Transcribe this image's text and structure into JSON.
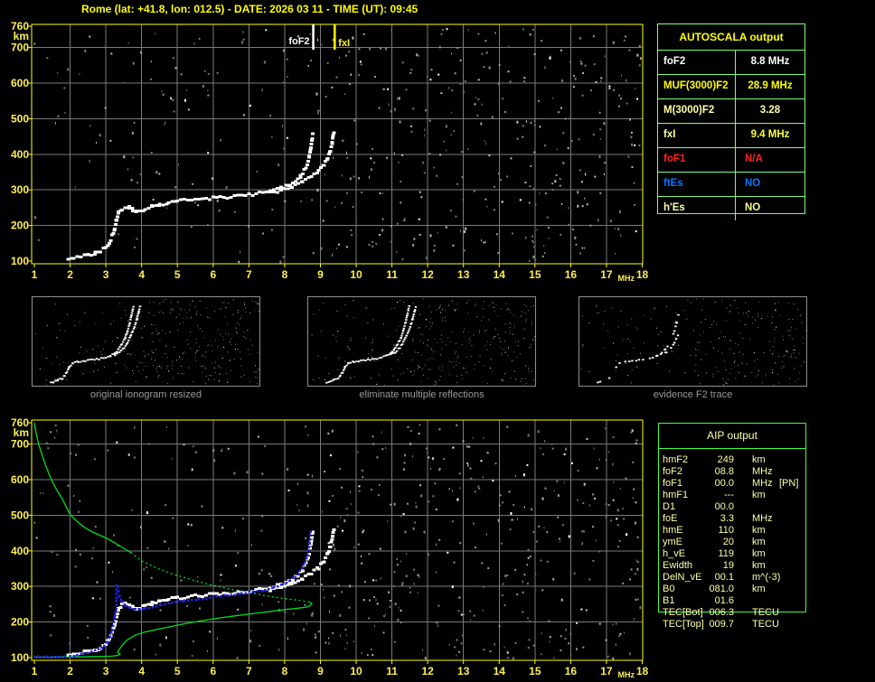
{
  "title": "Rome (lat: +41.8, lon: 012.5) - DATE: 2026 03 11 - TIME (UT): 09:45",
  "colors": {
    "background": "#000000",
    "title_yellow": "#ffff00",
    "axis_label": "#ffee55",
    "plot_border": "#ffff00",
    "grid": "#7a7a7a",
    "trace_white": "#ffffff",
    "trace_blue": "#2222ee",
    "profile_green": "#00dd22",
    "autoscala_border": "#7dff7d",
    "aip_border": "#3dff3d",
    "aip_text": "#ffffa8",
    "caption_gray": "#9a9a9a"
  },
  "autoscala": {
    "title": "AUTOSCALA output",
    "rows": [
      {
        "label": "foF2",
        "value": "8.8 MHz",
        "label_color": "#ffffff",
        "value_color": "#ffffff",
        "align": "center"
      },
      {
        "label": "MUF(3000)F2",
        "value": "28.9 MHz",
        "label_color": "#ffff00",
        "value_color": "#ffff00",
        "align": "center"
      },
      {
        "label": "M(3000)F2",
        "value": "3.28",
        "label_color": "#ffffaa",
        "value_color": "#ffffaa",
        "align": "center"
      },
      {
        "label": "fxI",
        "value": "9.4 MHz",
        "label_color": "#ffffaa",
        "value_color": "#ffff44",
        "align": "center"
      },
      {
        "label": "foF1",
        "value": "N/A",
        "label_color": "#ff2222",
        "value_color": "#ff2222",
        "align": "left"
      },
      {
        "label": "ftEs",
        "value": "NO",
        "label_color": "#0077ff",
        "value_color": "#0077ff",
        "align": "left"
      },
      {
        "label": "h'Es",
        "value": "NO",
        "label_color": "#ffffaa",
        "value_color": "#ffff88",
        "align": "left"
      }
    ]
  },
  "aip": {
    "title": "AIP output",
    "rows": [
      {
        "name": "hmF2",
        "value": "249",
        "unit": "km",
        "note": ""
      },
      {
        "name": "foF2",
        "value": "08.8",
        "unit": "MHz",
        "note": ""
      },
      {
        "name": "foF1",
        "value": "00.0",
        "unit": "MHz",
        "note": "[PN]"
      },
      {
        "name": "hmF1",
        "value": "---",
        "unit": "km",
        "note": ""
      },
      {
        "name": "D1",
        "value": "00.0",
        "unit": "",
        "note": ""
      },
      {
        "name": "foE",
        "value": "3.3",
        "unit": "MHz",
        "note": ""
      },
      {
        "name": "hmE",
        "value": "110",
        "unit": "km",
        "note": ""
      },
      {
        "name": "ymE",
        "value": "20",
        "unit": "km",
        "note": ""
      },
      {
        "name": "h_vE",
        "value": "119",
        "unit": "km",
        "note": ""
      },
      {
        "name": "Ewidth",
        "value": "19",
        "unit": "km",
        "note": ""
      },
      {
        "name": "DelN_vE",
        "value": "00.1",
        "unit": "m^(-3)",
        "note": ""
      },
      {
        "name": "B0",
        "value": "081.0",
        "unit": "km",
        "note": ""
      },
      {
        "name": "B1",
        "value": "01.6",
        "unit": "",
        "note": ""
      },
      {
        "name": "TEC[Bot]",
        "value": "006.3",
        "unit": "TECU",
        "note": ""
      },
      {
        "name": "TEC[Top]",
        "value": "009.7",
        "unit": "TECU",
        "note": ""
      }
    ]
  },
  "thumbnails": [
    {
      "caption": "original ionogram resized"
    },
    {
      "caption": "eliminate multiple reflections"
    },
    {
      "caption": "evidence F2 trace"
    }
  ],
  "chart_data": {
    "type": "scatter",
    "title": "ionogram virtual height vs frequency",
    "xlabel": "MHz",
    "ylabel": "km",
    "x_ticks": [
      1,
      2,
      3,
      4,
      5,
      6,
      7,
      8,
      9,
      10,
      11,
      12,
      13,
      14,
      15,
      16,
      17,
      18
    ],
    "y_ticks": [
      760,
      700,
      600,
      500,
      400,
      300,
      200,
      100
    ],
    "y_grid": [
      700,
      600,
      500,
      400,
      300,
      200
    ],
    "xlim": [
      1,
      18
    ],
    "ylim": [
      100,
      760
    ],
    "top_plot_markers": [
      {
        "label": "foF2",
        "f": 8.8,
        "color": "#ffffff"
      },
      {
        "label": "fxI",
        "f": 9.4,
        "color": "#ffff00"
      }
    ],
    "trace_o_mode": [
      [
        1.95,
        108
      ],
      [
        2.1,
        110
      ],
      [
        2.3,
        113
      ],
      [
        2.5,
        117
      ],
      [
        2.7,
        122
      ],
      [
        2.85,
        128
      ],
      [
        3.0,
        138
      ],
      [
        3.1,
        152
      ],
      [
        3.18,
        170
      ],
      [
        3.25,
        192
      ],
      [
        3.3,
        215
      ],
      [
        3.35,
        235
      ],
      [
        3.45,
        247
      ],
      [
        3.55,
        252
      ],
      [
        3.65,
        250
      ],
      [
        3.75,
        244
      ],
      [
        3.85,
        240
      ],
      [
        3.95,
        241
      ],
      [
        4.1,
        246
      ],
      [
        4.3,
        253
      ],
      [
        4.5,
        259
      ],
      [
        4.75,
        264
      ],
      [
        5.0,
        268
      ],
      [
        5.3,
        271
      ],
      [
        5.6,
        274
      ],
      [
        5.9,
        276
      ],
      [
        6.2,
        278
      ],
      [
        6.5,
        281
      ],
      [
        6.8,
        284
      ],
      [
        7.1,
        288
      ],
      [
        7.4,
        293
      ],
      [
        7.7,
        299
      ],
      [
        7.95,
        306
      ],
      [
        8.15,
        315
      ],
      [
        8.3,
        325
      ],
      [
        8.45,
        339
      ],
      [
        8.55,
        355
      ],
      [
        8.63,
        373
      ],
      [
        8.69,
        394
      ],
      [
        8.73,
        416
      ],
      [
        8.76,
        437
      ],
      [
        8.78,
        455
      ],
      [
        8.79,
        465
      ]
    ],
    "trace_x_mode": [
      [
        7.6,
        291
      ],
      [
        7.9,
        299
      ],
      [
        8.2,
        309
      ],
      [
        8.5,
        322
      ],
      [
        8.75,
        336
      ],
      [
        8.95,
        352
      ],
      [
        9.1,
        370
      ],
      [
        9.2,
        390
      ],
      [
        9.28,
        412
      ],
      [
        9.33,
        434
      ],
      [
        9.36,
        452
      ],
      [
        9.38,
        465
      ]
    ],
    "restored_trace_blue": [
      [
        [
          1.0,
          102
        ],
        [
          1.88,
          102
        ]
      ],
      [
        [
          2.0,
          104
        ],
        [
          2.2,
          108
        ],
        [
          2.4,
          112
        ],
        [
          2.6,
          117
        ],
        [
          2.8,
          124
        ],
        [
          2.95,
          133
        ],
        [
          3.05,
          146
        ],
        [
          3.12,
          161
        ],
        [
          3.18,
          179
        ],
        [
          3.23,
          199
        ],
        [
          3.26,
          218
        ],
        [
          3.28,
          234
        ]
      ],
      [
        [
          3.29,
          238
        ],
        [
          3.29,
          306
        ]
      ],
      [
        [
          3.33,
          296
        ],
        [
          3.38,
          272
        ],
        [
          3.45,
          256
        ],
        [
          3.55,
          246
        ],
        [
          3.68,
          239
        ],
        [
          3.82,
          235
        ],
        [
          3.95,
          235
        ],
        [
          4.1,
          238
        ],
        [
          4.3,
          243
        ],
        [
          4.55,
          249
        ],
        [
          4.85,
          255
        ],
        [
          5.2,
          260
        ],
        [
          5.6,
          265
        ],
        [
          6.0,
          270
        ],
        [
          6.4,
          275
        ],
        [
          6.8,
          280
        ],
        [
          7.15,
          285
        ],
        [
          7.45,
          291
        ],
        [
          7.7,
          298
        ],
        [
          7.95,
          306
        ],
        [
          8.15,
          316
        ],
        [
          8.3,
          328
        ],
        [
          8.43,
          342
        ],
        [
          8.53,
          359
        ],
        [
          8.61,
          379
        ],
        [
          8.66,
          400
        ],
        [
          8.7,
          422
        ],
        [
          8.72,
          443
        ],
        [
          8.73,
          460
        ]
      ]
    ],
    "profile_topside_solid": [
      [
        1.0,
        760
      ],
      [
        1.05,
        730
      ],
      [
        1.12,
        700
      ],
      [
        1.22,
        668
      ],
      [
        1.33,
        636
      ],
      [
        1.45,
        606
      ],
      [
        1.6,
        576
      ],
      [
        1.78,
        546
      ],
      [
        2.0,
        502
      ],
      [
        2.2,
        482
      ],
      [
        2.4,
        466
      ],
      [
        2.6,
        454
      ],
      [
        2.85,
        443
      ],
      [
        3.07,
        433
      ],
      [
        3.35,
        416
      ],
      [
        3.58,
        402
      ],
      [
        3.7,
        395
      ]
    ],
    "profile_dotted": [
      [
        3.7,
        395
      ],
      [
        4.0,
        372
      ],
      [
        4.4,
        352
      ],
      [
        4.8,
        337
      ],
      [
        5.2,
        325
      ],
      [
        5.6,
        313
      ],
      [
        6.0,
        303
      ],
      [
        6.5,
        292
      ],
      [
        7.0,
        283
      ],
      [
        7.5,
        273
      ],
      [
        8.0,
        266
      ],
      [
        8.4,
        261
      ],
      [
        8.7,
        256
      ]
    ],
    "profile_bottomside_solid": [
      [
        8.7,
        256
      ],
      [
        8.76,
        251
      ],
      [
        8.72,
        246
      ],
      [
        8.6,
        242
      ],
      [
        8.4,
        239
      ],
      [
        8.1,
        236
      ],
      [
        7.62,
        230
      ],
      [
        7.0,
        222
      ],
      [
        6.35,
        214
      ],
      [
        5.7,
        204
      ],
      [
        5.09,
        193
      ],
      [
        4.5,
        181
      ],
      [
        4.1,
        172
      ],
      [
        3.83,
        164
      ],
      [
        3.6,
        150
      ],
      [
        3.5,
        140
      ],
      [
        3.42,
        130
      ],
      [
        3.36,
        121
      ],
      [
        3.33,
        114
      ],
      [
        3.4,
        110
      ],
      [
        3.33,
        106
      ],
      [
        3.15,
        104
      ],
      [
        2.8,
        103
      ],
      [
        2.3,
        102
      ],
      [
        1.8,
        102
      ],
      [
        1.2,
        101
      ],
      [
        1.0,
        101
      ]
    ],
    "thumb_trace_o": [
      [
        8,
        95
      ],
      [
        9,
        94
      ],
      [
        11,
        92
      ],
      [
        13,
        90
      ],
      [
        14,
        87
      ],
      [
        15,
        83
      ],
      [
        16,
        77
      ],
      [
        17.5,
        73
      ],
      [
        20,
        71.5
      ],
      [
        23,
        70.5
      ],
      [
        26,
        69.5
      ],
      [
        29,
        68.5
      ],
      [
        32,
        67
      ],
      [
        34,
        65
      ],
      [
        36,
        62
      ],
      [
        37.5,
        58
      ],
      [
        39,
        52
      ],
      [
        40.5,
        45
      ],
      [
        41.5,
        37
      ],
      [
        42.5,
        28
      ],
      [
        43.2,
        20
      ],
      [
        43.8,
        13
      ],
      [
        44.2,
        9
      ]
    ],
    "thumb_trace_x": [
      [
        36,
        64
      ],
      [
        38,
        61
      ],
      [
        40,
        56
      ],
      [
        41.5,
        50
      ],
      [
        43,
        42
      ],
      [
        44.5,
        33
      ],
      [
        45.6,
        24
      ],
      [
        46.4,
        16
      ],
      [
        47,
        10
      ]
    ]
  }
}
